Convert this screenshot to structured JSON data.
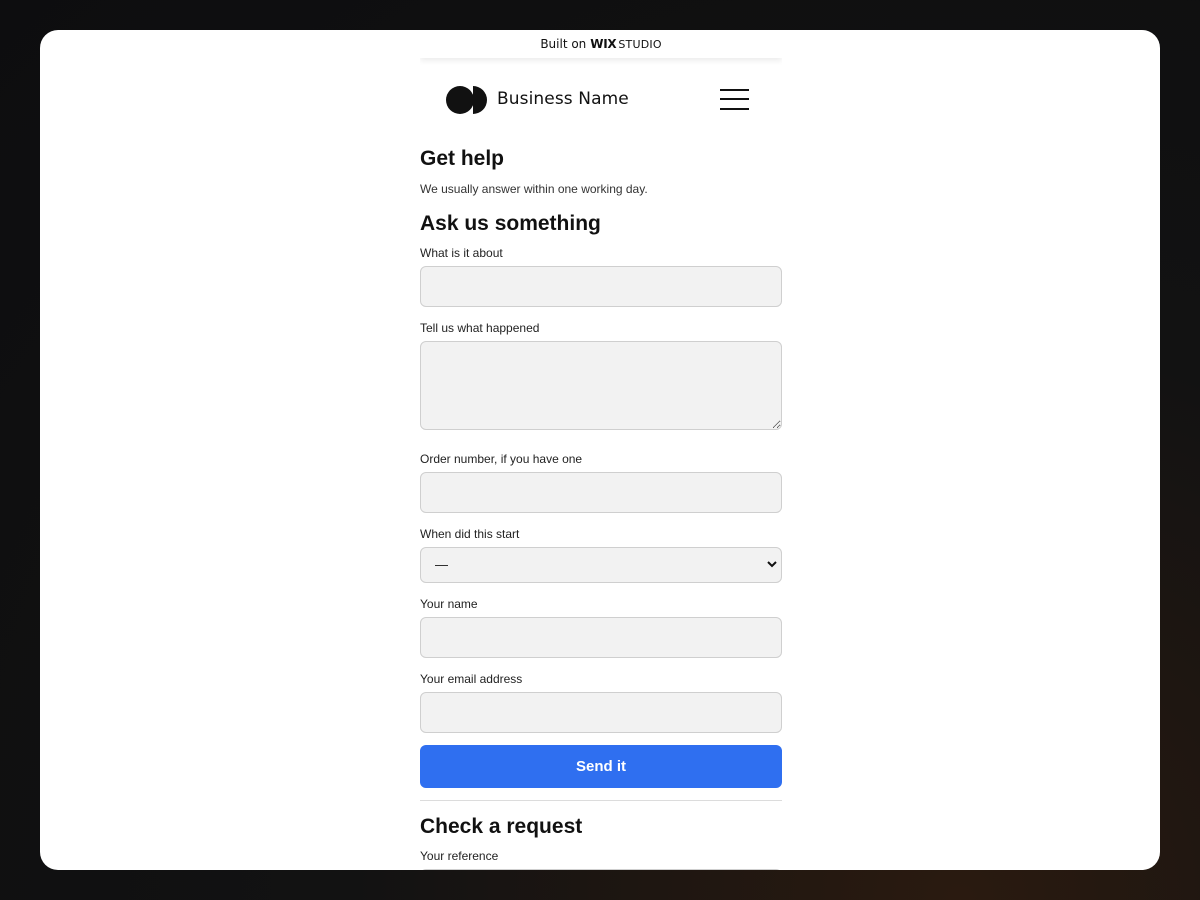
{
  "wix_bar": {
    "prefix": "Built on",
    "brand": "WIX",
    "suffix": "STUDIO"
  },
  "header": {
    "business_name": "Business Name"
  },
  "page": {
    "title": "Get help",
    "intro": "We usually answer within one working day."
  },
  "ask_form": {
    "heading": "Ask us something",
    "about_label": "What is it about",
    "about_value": "",
    "happened_label": "Tell us what happened",
    "happened_value": "",
    "order_label": "Order number, if you have one",
    "order_value": "",
    "start_label": "When did this start",
    "start_selected": "—",
    "name_label": "Your name",
    "name_value": "",
    "email_label": "Your email address",
    "email_value": "",
    "submit_label": "Send it"
  },
  "check_request": {
    "heading": "Check a request",
    "reference_label": "Your reference"
  },
  "colors": {
    "primary_button": "#2f6ff0",
    "field_background": "#f2f2f2"
  },
  "icons": [
    "logo-icon",
    "hamburger-menu-icon",
    "chevron-down-icon"
  ]
}
